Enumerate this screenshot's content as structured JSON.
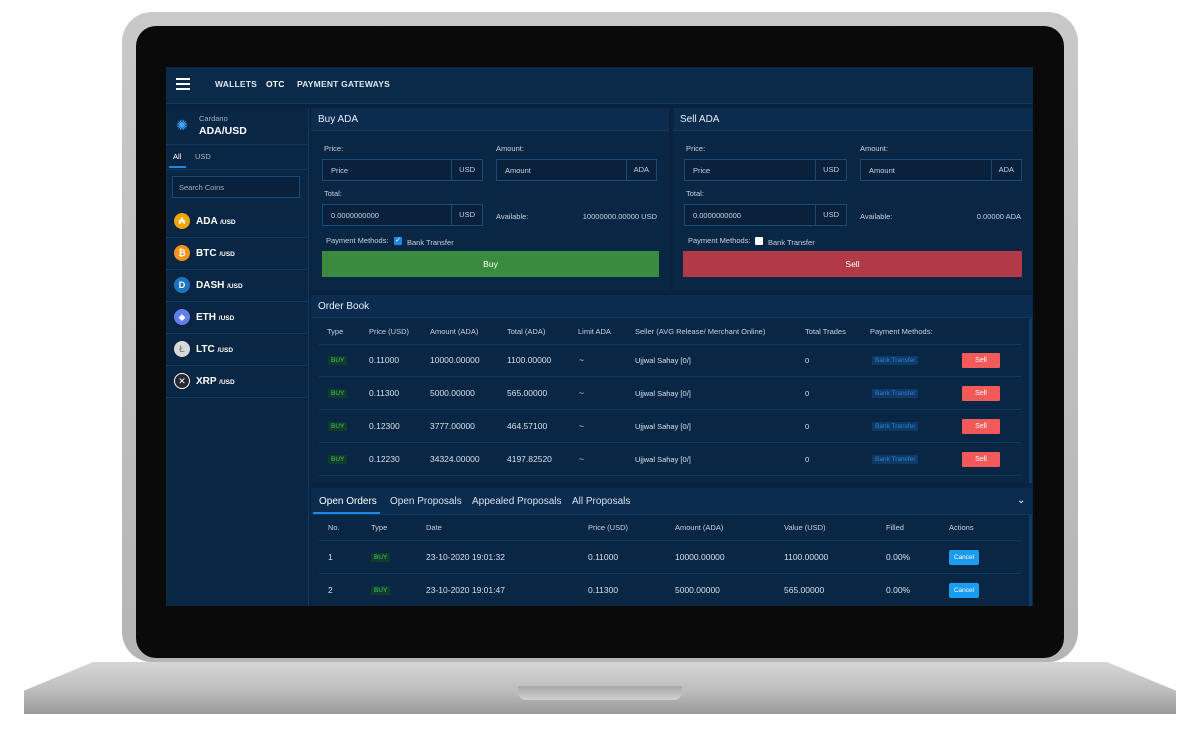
{
  "nav": {
    "wallets": "WALLETS",
    "otc": "OTC",
    "gateways": "PAYMENT GATEWAYS"
  },
  "pair": {
    "name": "Cardano",
    "symbol": "ADA/USD"
  },
  "sidebar": {
    "tabs": [
      "All",
      "USD"
    ],
    "search_placeholder": "Search Coins",
    "coins": [
      {
        "name": "ADA",
        "quote": "/USD",
        "icon": "ada-icon",
        "color": "#f0a500"
      },
      {
        "name": "BTC",
        "quote": "/USD",
        "icon": "btc-icon",
        "color": "#f7931a"
      },
      {
        "name": "DASH",
        "quote": "/USD",
        "icon": "dash-icon",
        "color": "#1c75bc"
      },
      {
        "name": "ETH",
        "quote": "/USD",
        "icon": "eth-icon",
        "color": "#627eea"
      },
      {
        "name": "LTC",
        "quote": "/USD",
        "icon": "ltc-icon",
        "color": "#d9d9d9"
      },
      {
        "name": "XRP",
        "quote": "/USD",
        "icon": "xrp-icon",
        "color": "#23292f"
      }
    ]
  },
  "buy": {
    "title": "Buy ADA",
    "price_label": "Price:",
    "price_placeholder": "Price",
    "price_unit": "USD",
    "amount_label": "Amount:",
    "amount_placeholder": "Amount",
    "amount_unit": "ADA",
    "total_label": "Total:",
    "total_value": "0.0000000000",
    "total_unit": "USD",
    "available_label": "Available:",
    "available_value": "10000000.00000 USD",
    "payment_label": "Payment Methods:",
    "bank": "Bank Transfer",
    "bank_checked": true,
    "button": "Buy"
  },
  "sell": {
    "title": "Sell ADA",
    "price_label": "Price:",
    "price_placeholder": "Price",
    "price_unit": "USD",
    "amount_label": "Amount:",
    "amount_placeholder": "Amount",
    "amount_unit": "ADA",
    "total_label": "Total:",
    "total_value": "0.0000000000",
    "total_unit": "USD",
    "available_label": "Available:",
    "available_value": "0.00000 ADA",
    "payment_label": "Payment Methods:",
    "bank": "Bank Transfer",
    "bank_checked": false,
    "button": "Sell"
  },
  "orderbook": {
    "title": "Order Book",
    "headers": [
      "Type",
      "Price (USD)",
      "Amount (ADA)",
      "Total (ADA)",
      "Limit ADA",
      "Seller (AVG Release/ Merchant Online)",
      "Total Trades",
      "Payment Methods:"
    ],
    "rows": [
      {
        "type": "BUY",
        "price": "0.11000",
        "amount": "10000.00000",
        "total": "1100.00000",
        "limit": "~",
        "seller": "Ujjwal Sahay [0/]",
        "trades": "0",
        "payment": "Bank Transfer",
        "action": "Sell"
      },
      {
        "type": "BUY",
        "price": "0.11300",
        "amount": "5000.00000",
        "total": "565.00000",
        "limit": "~",
        "seller": "Ujjwal Sahay [0/]",
        "trades": "0",
        "payment": "Bank Transfer",
        "action": "Sell"
      },
      {
        "type": "BUY",
        "price": "0.12300",
        "amount": "3777.00000",
        "total": "464.57100",
        "limit": "~",
        "seller": "Ujjwal Sahay [0/]",
        "trades": "0",
        "payment": "Bank Transfer",
        "action": "Sell"
      },
      {
        "type": "BUY",
        "price": "0.12230",
        "amount": "34324.00000",
        "total": "4197.82520",
        "limit": "~",
        "seller": "Ujjwal Sahay [0/]",
        "trades": "0",
        "payment": "Bank Transfer",
        "action": "Sell"
      }
    ]
  },
  "orders": {
    "tabs": [
      "Open Orders",
      "Open Proposals",
      "Appealed Proposals",
      "All Proposals"
    ],
    "headers": [
      "No.",
      "Type",
      "Date",
      "Price (USD)",
      "Amount (ADA)",
      "Value (USD)",
      "Filled",
      "Actions"
    ],
    "rows": [
      {
        "no": "1",
        "type": "BUY",
        "date": "23-10-2020 19:01:32",
        "price": "0.11000",
        "amount": "10000.00000",
        "value": "1100.00000",
        "filled": "0.00%",
        "action": "Cancel"
      },
      {
        "no": "2",
        "type": "BUY",
        "date": "23-10-2020 19:01:47",
        "price": "0.11300",
        "amount": "5000.00000",
        "value": "565.00000",
        "filled": "0.00%",
        "action": "Cancel"
      }
    ]
  },
  "colors": {
    "buy": "#3a8b3e",
    "sell": "#b13a46",
    "accent": "#1e88e5",
    "background": "#08223f"
  }
}
